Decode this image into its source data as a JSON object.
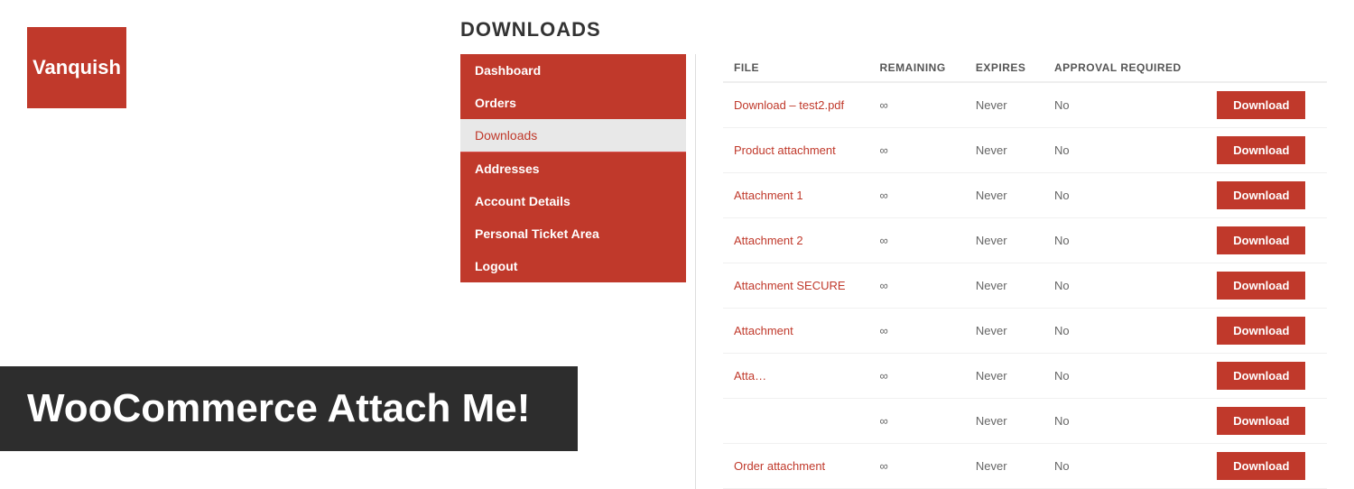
{
  "logo": {
    "text": "Vanquish"
  },
  "section_title": "DOWNLOADS",
  "nav": {
    "items": [
      {
        "label": "Dashboard",
        "style": "active-red"
      },
      {
        "label": "Orders",
        "style": "active-red"
      },
      {
        "label": "Downloads",
        "style": "active-light"
      },
      {
        "label": "Addresses",
        "style": "active-red divider-top"
      },
      {
        "label": "Account Details",
        "style": "active-red"
      },
      {
        "label": "Personal Ticket Area",
        "style": "active-red"
      },
      {
        "label": "Logout",
        "style": "active-red"
      }
    ]
  },
  "table": {
    "headers": [
      "FILE",
      "REMAINING",
      "EXPIRES",
      "APPROVAL REQUIRED",
      ""
    ],
    "rows": [
      {
        "file": "Download – test2.pdf",
        "remaining": "∞",
        "expires": "Never",
        "approval": "No"
      },
      {
        "file": "Product attachment",
        "remaining": "∞",
        "expires": "Never",
        "approval": "No"
      },
      {
        "file": "Attachment 1",
        "remaining": "∞",
        "expires": "Never",
        "approval": "No"
      },
      {
        "file": "Attachment 2",
        "remaining": "∞",
        "expires": "Never",
        "approval": "No"
      },
      {
        "file": "Attachment SECURE",
        "remaining": "∞",
        "expires": "Never",
        "approval": "No"
      },
      {
        "file": "Attachment",
        "remaining": "∞",
        "expires": "Never",
        "approval": "No"
      },
      {
        "file": "Atta…",
        "remaining": "∞",
        "expires": "Never",
        "approval": "No"
      },
      {
        "file": "",
        "remaining": "∞",
        "expires": "Never",
        "approval": "No"
      },
      {
        "file": "Order attachment",
        "remaining": "∞",
        "expires": "Never",
        "approval": "No"
      }
    ],
    "button_label": "Download"
  },
  "banner": {
    "text": "WooCommerce Attach Me!"
  }
}
